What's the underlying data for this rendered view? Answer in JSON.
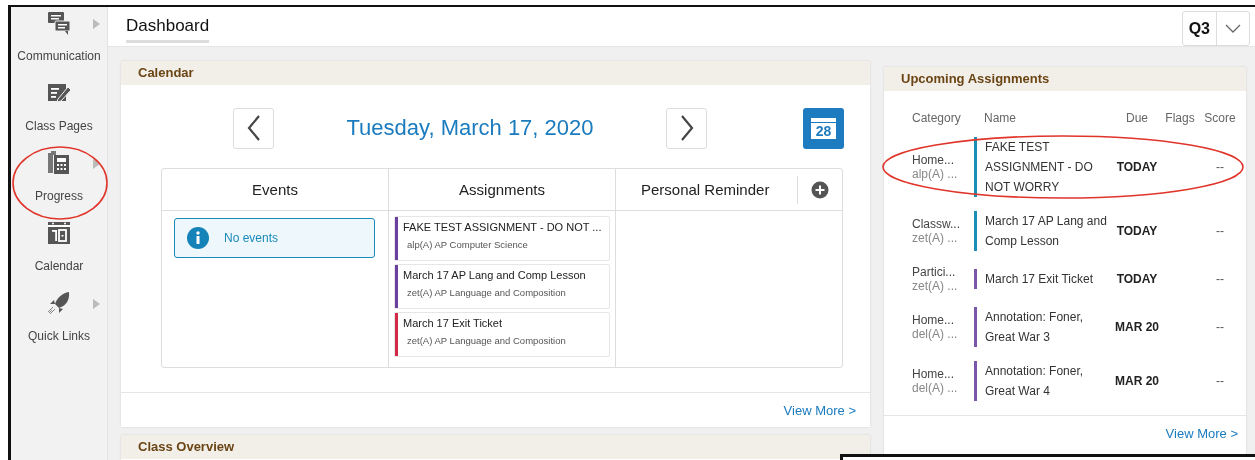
{
  "sidebar": {
    "items": [
      {
        "label": "Communication",
        "kind": "chat",
        "has_submenu": true,
        "circled": false
      },
      {
        "label": "Class Pages",
        "kind": "edit",
        "has_submenu": false,
        "circled": false
      },
      {
        "label": "Progress",
        "kind": "calculator",
        "has_submenu": true,
        "circled": true
      },
      {
        "label": "Calendar",
        "kind": "calendar",
        "has_submenu": false,
        "circled": false
      },
      {
        "label": "Quick Links",
        "kind": "rocket",
        "has_submenu": true,
        "circled": false
      }
    ]
  },
  "header": {
    "title": "Dashboard",
    "term_selector": {
      "value": "Q3"
    }
  },
  "calendar": {
    "title": "Calendar",
    "date": "Tuesday, March 17, 2020",
    "calendar_icon_day": "28",
    "columns": [
      "Events",
      "Assignments",
      "Personal Reminder"
    ],
    "events_notice": "No events",
    "assignments": [
      {
        "title": "FAKE TEST ASSIGNMENT - DO NOT ...",
        "course": "alp(A) AP Computer Science",
        "color": "#6b3fa0"
      },
      {
        "title": "March 17 AP Lang and Comp Lesson",
        "course": "zet(A) AP Language and Composition",
        "color": "#6b3fa0"
      },
      {
        "title": "March 17 Exit Ticket",
        "course": "zet(A) AP Language and Composition",
        "color": "#d42a4a"
      }
    ],
    "view_more": "View More >"
  },
  "class_overview": {
    "title": "Class Overview"
  },
  "upcoming": {
    "title": "Upcoming Assignments",
    "columns": [
      "Category",
      "Name",
      "Due",
      "Flags",
      "Score"
    ],
    "rows": [
      {
        "category": "Home...",
        "course": "alp(A) ...",
        "name": "FAKE TEST ASSIGNMENT - DO NOT WORRY",
        "due": "TODAY",
        "score": "--",
        "color": "#1a8fb5",
        "circled": true
      },
      {
        "category": "Classw...",
        "course": "zet(A) ...",
        "name": "March 17 AP Lang and Comp Lesson",
        "due": "TODAY",
        "score": "--",
        "color": "#1a8fb5",
        "circled": false
      },
      {
        "category": "Partici...",
        "course": "zet(A) ...",
        "name": "March 17 Exit Ticket",
        "due": "TODAY",
        "score": "--",
        "color": "#7b55a8",
        "circled": false
      },
      {
        "category": "Home...",
        "course": "del(A) ...",
        "name": "Annotation: Foner, Great War 3",
        "due": "MAR 20",
        "score": "--",
        "color": "#7b55a8",
        "circled": false
      },
      {
        "category": "Home...",
        "course": "del(A) ...",
        "name": "Annotation: Foner, Great War 4",
        "due": "MAR 20",
        "score": "--",
        "color": "#7b55a8",
        "circled": false
      }
    ],
    "view_more": "View More >"
  }
}
